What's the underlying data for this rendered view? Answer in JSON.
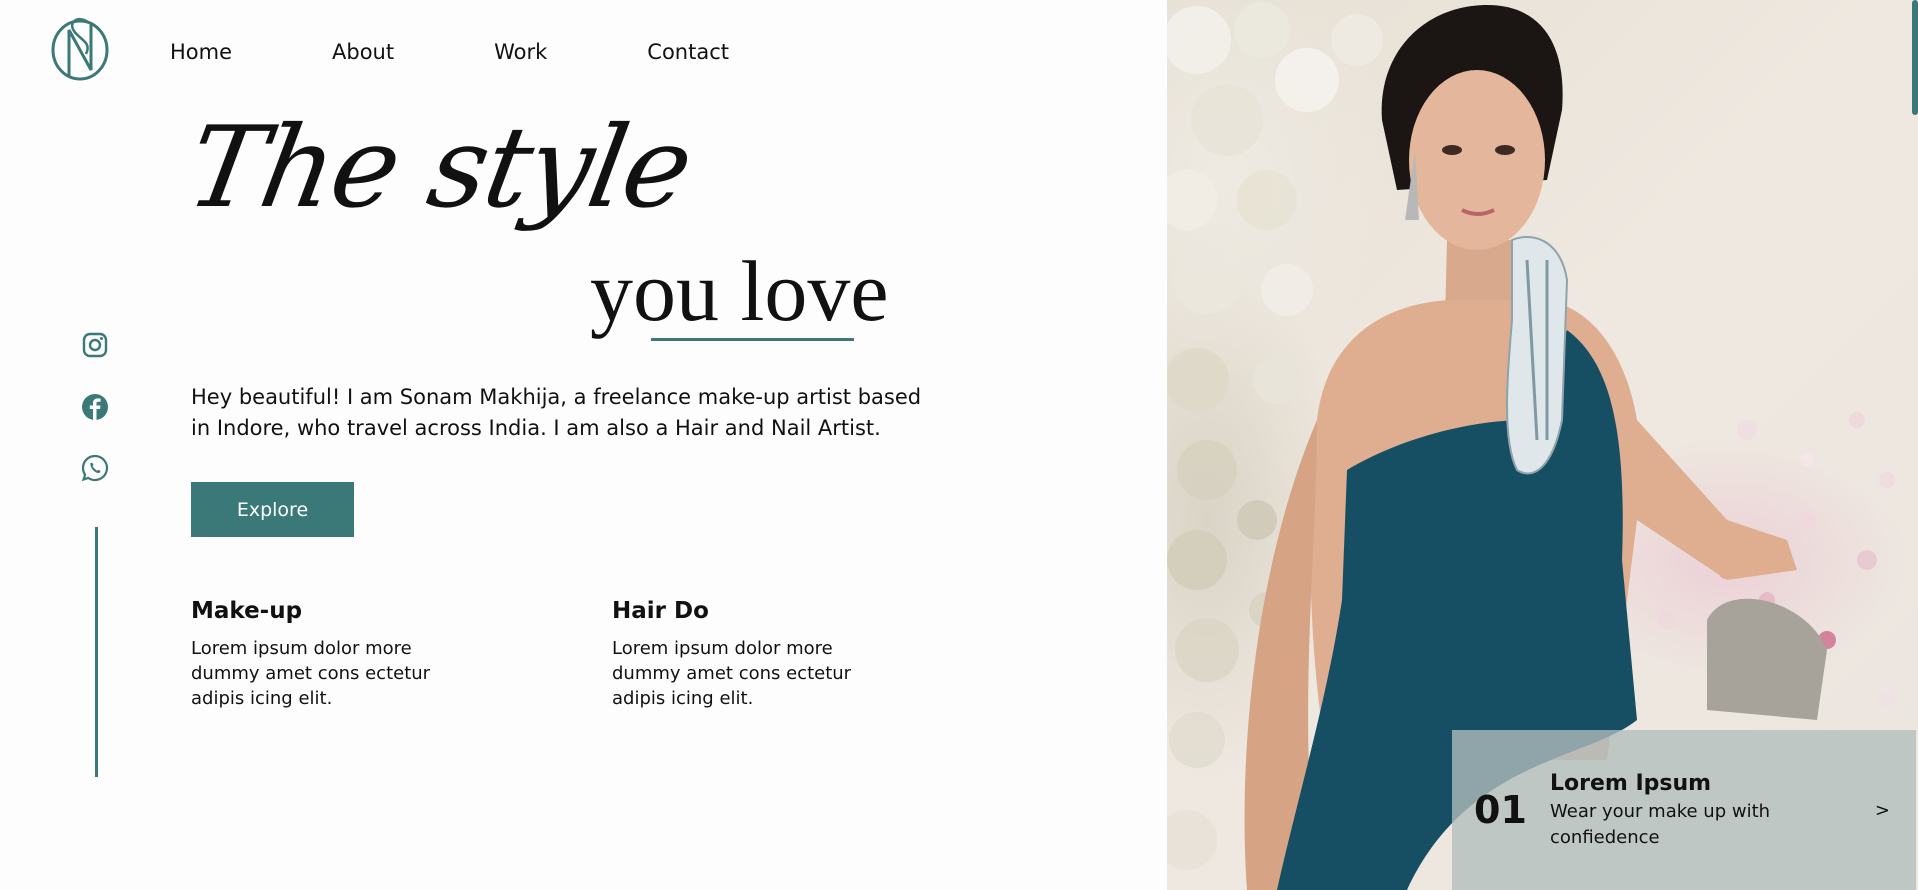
{
  "nav": {
    "items": [
      {
        "label": "Home"
      },
      {
        "label": "About"
      },
      {
        "label": "Work"
      },
      {
        "label": "Contact"
      }
    ]
  },
  "hero": {
    "line1": "The style",
    "line2": "you love",
    "intro": "Hey beautiful! I am Sonam Makhija, a freelance make-up artist based in Indore, who travel across India. I am also a Hair and Nail Artist.",
    "explore_label": "Explore"
  },
  "services": [
    {
      "title": "Make-up",
      "desc": "Lorem ipsum dolor more dummy amet cons ectetur adipis icing elit."
    },
    {
      "title": "Hair Do",
      "desc": "Lorem ipsum dolor more dummy amet cons ectetur adipis icing elit."
    }
  ],
  "social": [
    "instagram-icon",
    "facebook-icon",
    "whatsapp-icon"
  ],
  "card": {
    "number": "01",
    "title": "Lorem Ipsum",
    "subtitle": "Wear your make up with confiedence",
    "arrow": ">"
  },
  "colors": {
    "accent": "#3b7878",
    "background": "#fdfdfd",
    "text": "#111111"
  }
}
